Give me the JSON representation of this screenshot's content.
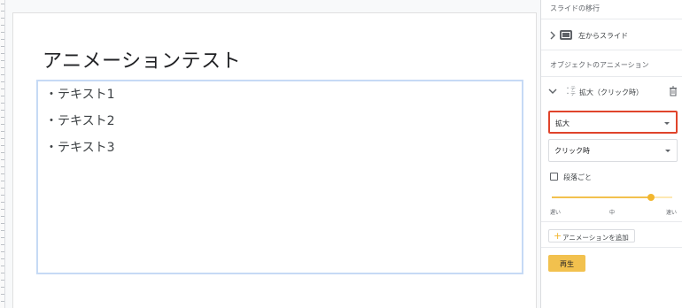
{
  "slide": {
    "title": "アニメーションテスト",
    "bullets": [
      "・テキスト1",
      "・テキスト2",
      "・テキスト3"
    ]
  },
  "panel": {
    "transition_header": "スライドの移行",
    "transition_item": "左からスライド",
    "object_anim_header": "オブジェクトのアニメーション",
    "anim_item": {
      "thumb_text": "・テ\n・テ",
      "label": "拡大（クリック時）"
    },
    "effect_select": {
      "value": "拡大"
    },
    "trigger_select": {
      "value": "クリック時"
    },
    "by_paragraph_label": "段落ごと",
    "speed": {
      "slow": "遅い",
      "medium": "中",
      "fast": "速い",
      "level": 0.82
    },
    "add_animation_label": "アニメーションを追加",
    "play_label": "再生"
  },
  "colors": {
    "accent_yellow": "#f2c14e",
    "highlight_red": "#e0442b",
    "text_box_border": "#c6daf5"
  }
}
